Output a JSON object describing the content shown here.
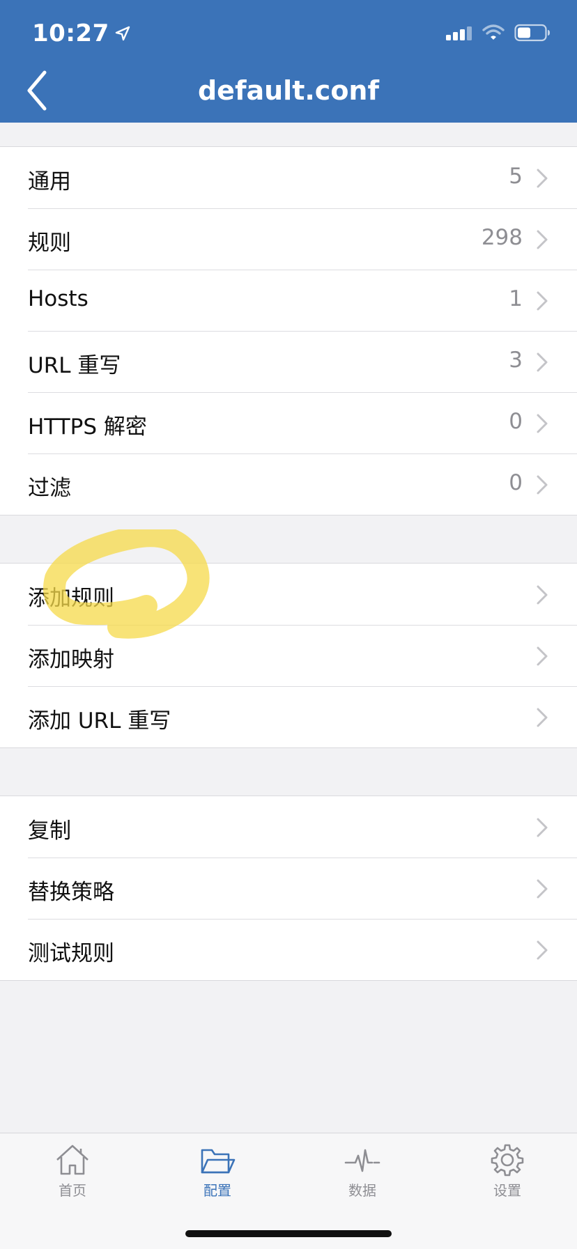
{
  "status_bar": {
    "time": "10:27"
  },
  "nav": {
    "title": "default.conf"
  },
  "section1": [
    {
      "label": "通用",
      "value": "5"
    },
    {
      "label": "规则",
      "value": "298"
    },
    {
      "label": "Hosts",
      "value": "1"
    },
    {
      "label": "URL 重写",
      "value": "3"
    },
    {
      "label": "HTTPS 解密",
      "value": "0"
    },
    {
      "label": "过滤",
      "value": "0"
    }
  ],
  "section2": [
    {
      "label": "添加规则"
    },
    {
      "label": "添加映射"
    },
    {
      "label": "添加 URL 重写"
    }
  ],
  "section3": [
    {
      "label": "复制"
    },
    {
      "label": "替换策略"
    },
    {
      "label": "测试规则"
    }
  ],
  "tabs": [
    {
      "label": "首页",
      "icon": "home-icon"
    },
    {
      "label": "配置",
      "icon": "folder-icon",
      "active": true
    },
    {
      "label": "数据",
      "icon": "pulse-icon"
    },
    {
      "label": "设置",
      "icon": "gear-icon"
    }
  ],
  "colors": {
    "accent": "#3b73b8",
    "highlight": "#f5d94a"
  }
}
